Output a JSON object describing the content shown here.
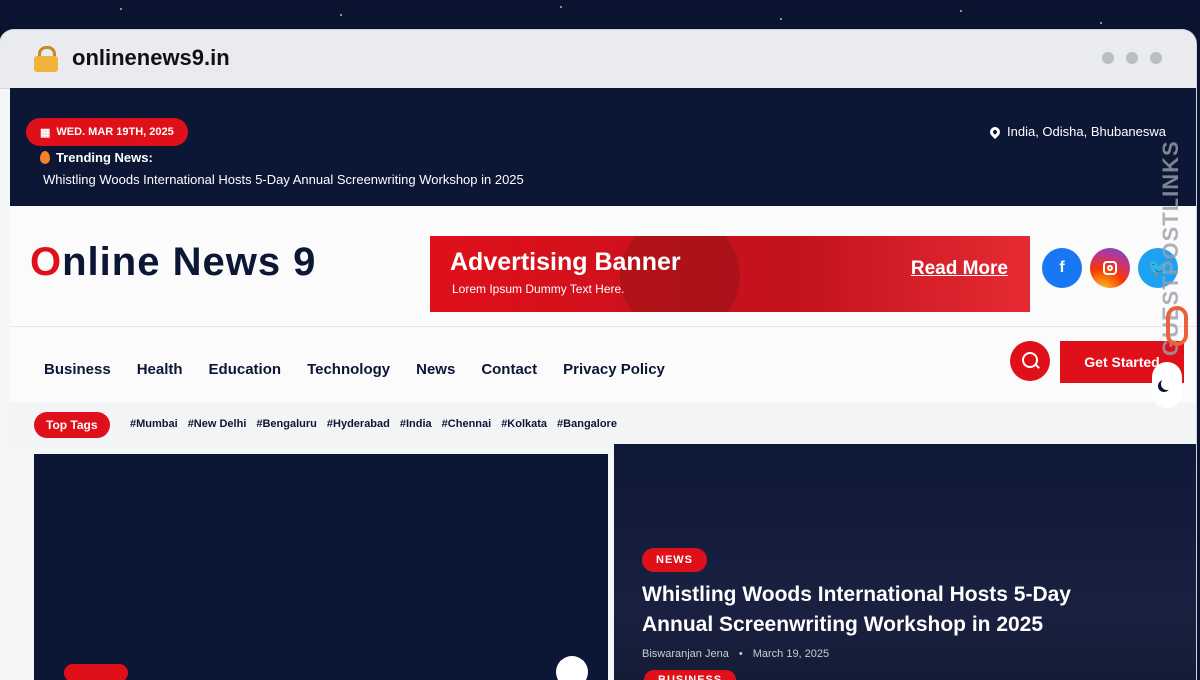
{
  "browser": {
    "url": "onlinenews9.in"
  },
  "topbar": {
    "date": "WED. MAR 19TH, 2025",
    "trending_label": "Trending News:",
    "trending_headline": "Whistling Woods International Hosts 5-Day Annual Screenwriting Workshop in 2025",
    "location": "India, Odisha, Bhubaneswa"
  },
  "header": {
    "logo_first": "O",
    "logo_rest": "nline News 9",
    "ad_title": "Advertising Banner",
    "ad_subtitle": "Lorem Ipsum Dummy Text Here.",
    "ad_cta": "Read More",
    "social": [
      {
        "name": "facebook",
        "glyph": "f"
      },
      {
        "name": "instagram",
        "glyph": ""
      },
      {
        "name": "twitter",
        "glyph": "🐦"
      }
    ]
  },
  "nav": {
    "items": [
      "Business",
      "Health",
      "Education",
      "Technology",
      "News",
      "Contact",
      "Privacy Policy"
    ],
    "cta": "Get Started"
  },
  "tags": {
    "label": "Top Tags",
    "items": [
      "#Mumbai",
      "#New Delhi",
      "#Bengaluru",
      "#Hyderabad",
      "#India",
      "#Chennai",
      "#Kolkata",
      "#Bangalore"
    ]
  },
  "featured": {
    "category": "NEWS",
    "headline": "Whistling Woods International Hosts 5-Day Annual Screenwriting Workshop in 2025",
    "author": "Biswaranjan Jena",
    "separator": "•",
    "date": "March 19, 2025",
    "second_category": "BUSINESS"
  },
  "watermark": "GUESTPOSTLINKS",
  "colors": {
    "accent": "#e0101b",
    "navy": "#0c1635"
  }
}
